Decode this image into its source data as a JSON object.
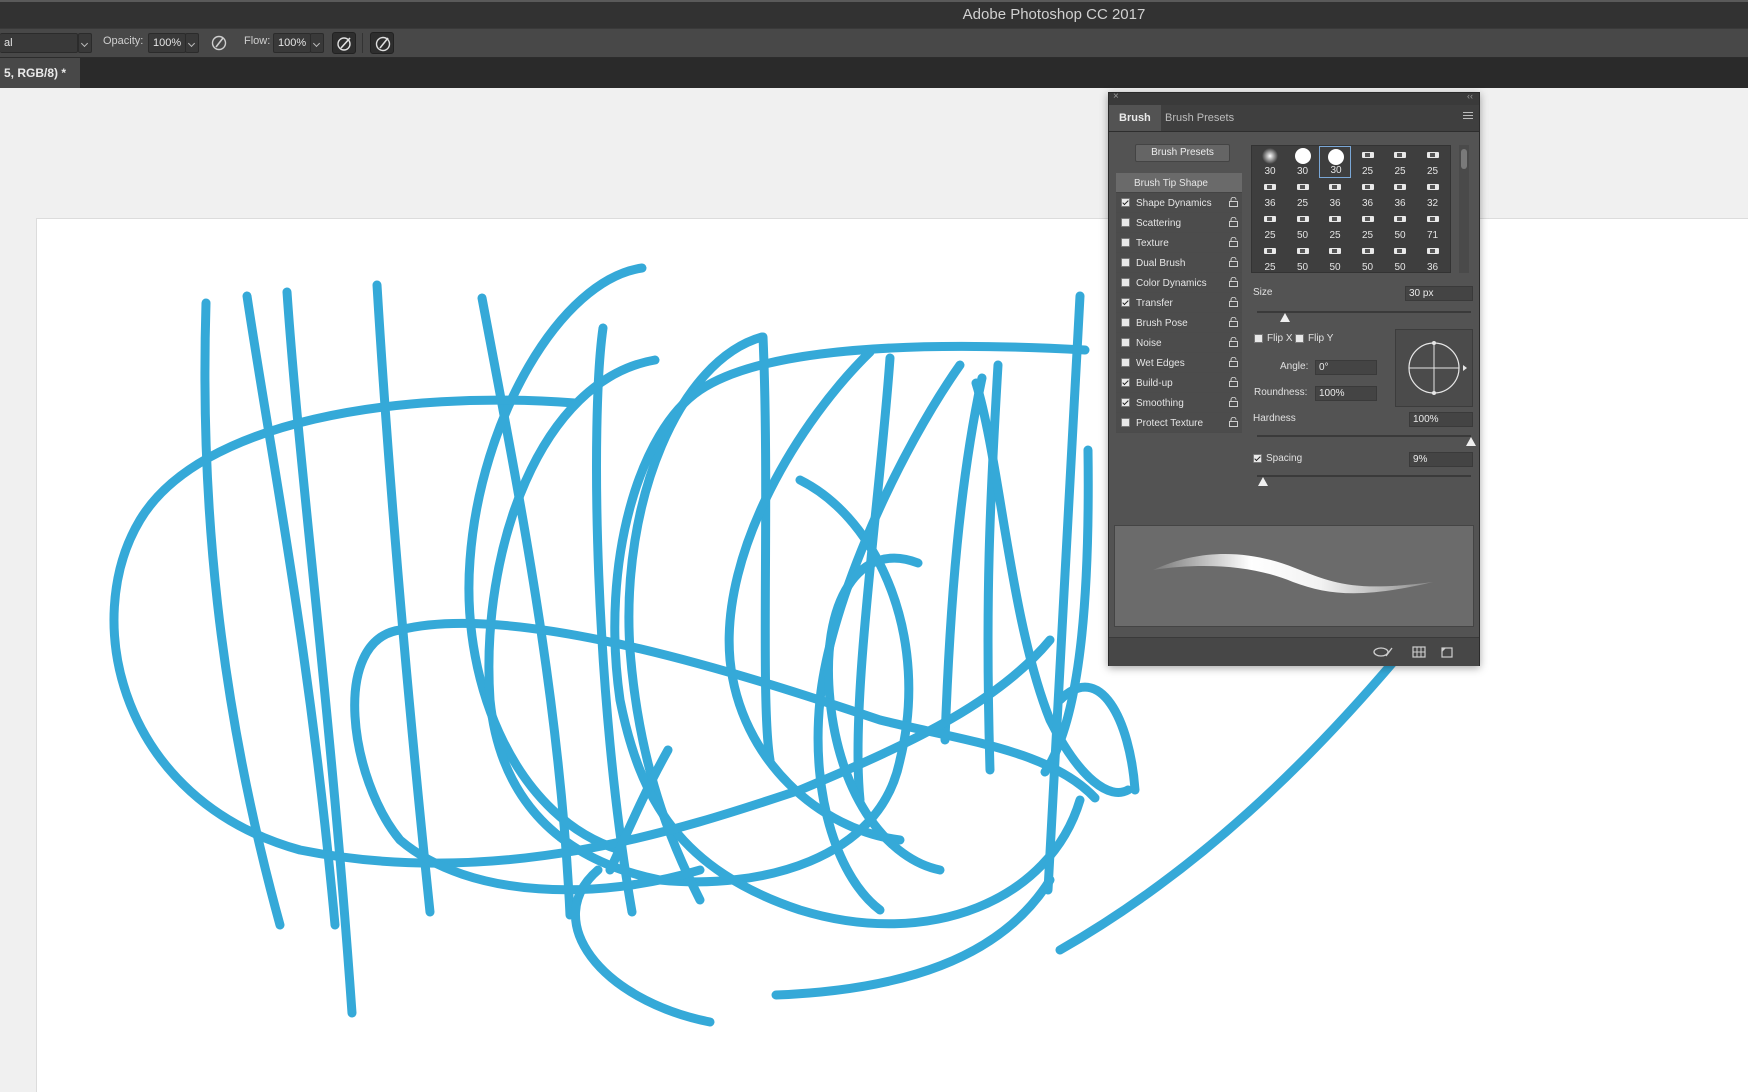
{
  "app": {
    "title": "Adobe Photoshop CC 2017"
  },
  "options_bar": {
    "mode_value": "al",
    "opacity_label": "Opacity:",
    "opacity_value": "100%",
    "flow_label": "Flow:",
    "flow_value": "100%"
  },
  "document_tab": {
    "label": "5, RGB/8) *"
  },
  "brush_panel": {
    "tabs": [
      "Brush",
      "Brush Presets"
    ],
    "presets_button": "Brush Presets",
    "sections": [
      {
        "label": "Brush Tip Shape",
        "header": true
      },
      {
        "label": "Shape Dynamics",
        "checked": true
      },
      {
        "label": "Scattering",
        "checked": false
      },
      {
        "label": "Texture",
        "checked": false
      },
      {
        "label": "Dual Brush",
        "checked": false
      },
      {
        "label": "Color Dynamics",
        "checked": false
      },
      {
        "label": "Transfer",
        "checked": true
      },
      {
        "label": "Brush Pose",
        "checked": false
      },
      {
        "label": "Noise",
        "checked": false
      },
      {
        "label": "Wet Edges",
        "checked": false
      },
      {
        "label": "Build-up",
        "checked": true
      },
      {
        "label": "Smoothing",
        "checked": true
      },
      {
        "label": "Protect Texture",
        "checked": false
      }
    ],
    "preset_sizes": [
      [
        "30",
        "30",
        "30",
        "25",
        "25",
        "25"
      ],
      [
        "36",
        "25",
        "36",
        "36",
        "36",
        "32"
      ],
      [
        "25",
        "50",
        "25",
        "25",
        "50",
        "71"
      ],
      [
        "25",
        "50",
        "50",
        "50",
        "50",
        "36"
      ]
    ],
    "size_label": "Size",
    "size_value": "30 px",
    "size_level": 0.13,
    "flip_x_label": "Flip X",
    "flip_y_label": "Flip Y",
    "angle_label": "Angle:",
    "angle_value": "0°",
    "roundness_label": "Roundness:",
    "roundness_value": "100%",
    "hardness_label": "Hardness",
    "hardness_value": "100%",
    "hardness_level": 1.0,
    "spacing_label": "Spacing",
    "spacing_checked": true,
    "spacing_value": "9%",
    "spacing_level": 0.03
  },
  "colors": {
    "stroke": "#35a9d8",
    "chrome_dark": "#323232",
    "panel": "#535353"
  }
}
